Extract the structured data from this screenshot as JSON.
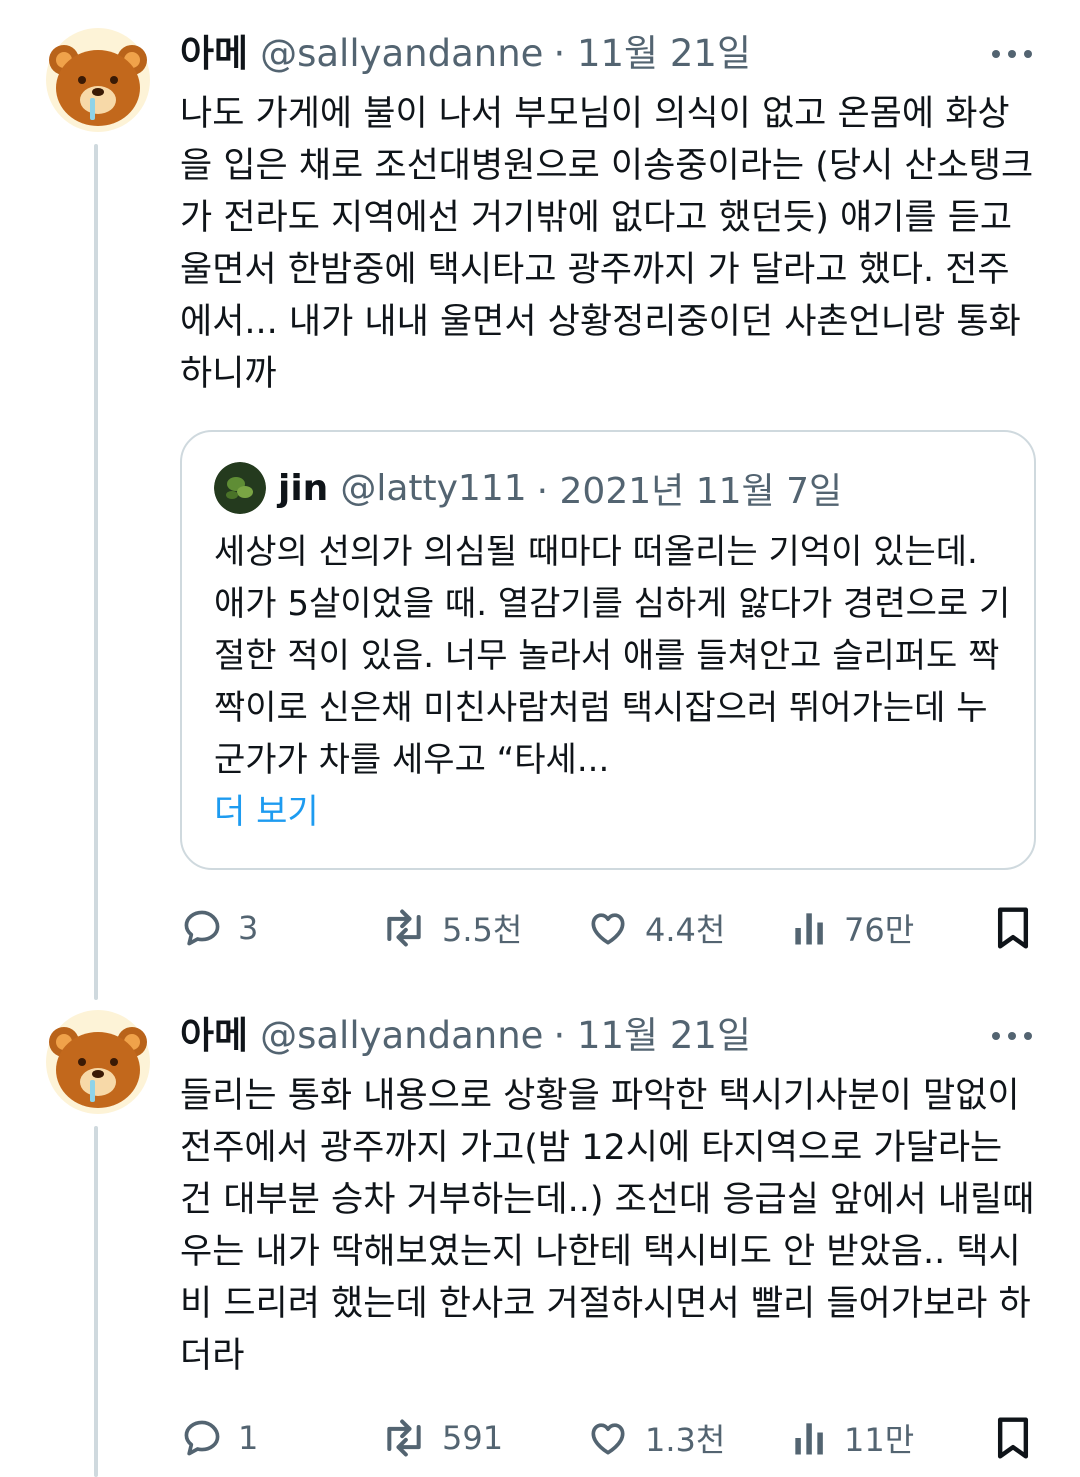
{
  "posts": [
    {
      "author": {
        "display_name": "아메",
        "handle": "@sallyandanne",
        "time": "· 11월 21일"
      },
      "text": "나도 가게에 불이 나서 부모님이 의식이 없고 온몸에 화상을 입은 채로 조선대병원으로 이송중이라는 (당시 산소탱크가 전라도 지역에선 거기밖에 없다고 했던듯) 얘기를 듣고 울면서 한밤중에 택시타고 광주까지 가 달라고 했다. 전주에서... 내가 내내 울면서 상황정리중이던 사촌언니랑 통화하니까",
      "quote": {
        "display_name": "jin",
        "handle": "@latty111",
        "time": "· 2021년 11월 7일",
        "text": "세상의 선의가 의심될 때마다 떠올리는 기억이 있는데. 애가 5살이었을 때. 열감기를 심하게 앓다가 경련으로 기절한 적이 있음. 너무 놀라서 애를 들쳐안고 슬리퍼도 짝짝이로 신은채 미친사람처럼 택시잡으러 뛰어가는데 누군가가 차를 세우고 “타세...",
        "more_label": "더 보기"
      },
      "stats": {
        "replies": "3",
        "reposts": "5.5천",
        "likes": "4.4천",
        "views": "76만"
      }
    },
    {
      "author": {
        "display_name": "아메",
        "handle": "@sallyandanne",
        "time": "· 11월 21일"
      },
      "text": "들리는 통화 내용으로 상황을 파악한 택시기사분이 말없이 전주에서 광주까지 가고(밤 12시에 타지역으로 가달라는 건 대부분 승차 거부하는데..) 조선대 응급실 앞에서 내릴때 우는 내가 딱해보였는지 나한테 택시비도 안 받았음.. 택시비 드리려 했는데 한사코 거절하시면서 빨리 들어가보라 하더라",
      "stats": {
        "replies": "1",
        "reposts": "591",
        "likes": "1.3천",
        "views": "11만"
      }
    }
  ],
  "icons": {
    "reply": "speech-bubble-icon",
    "repost": "repost-arrows-icon",
    "like": "heart-icon",
    "views": "bar-chart-icon",
    "bookmark": "bookmark-icon",
    "more": "more-dots-icon"
  },
  "colors": {
    "text": "#0f1419",
    "secondary": "#536471",
    "link": "#1d9bf0",
    "border": "#cfd9de"
  }
}
